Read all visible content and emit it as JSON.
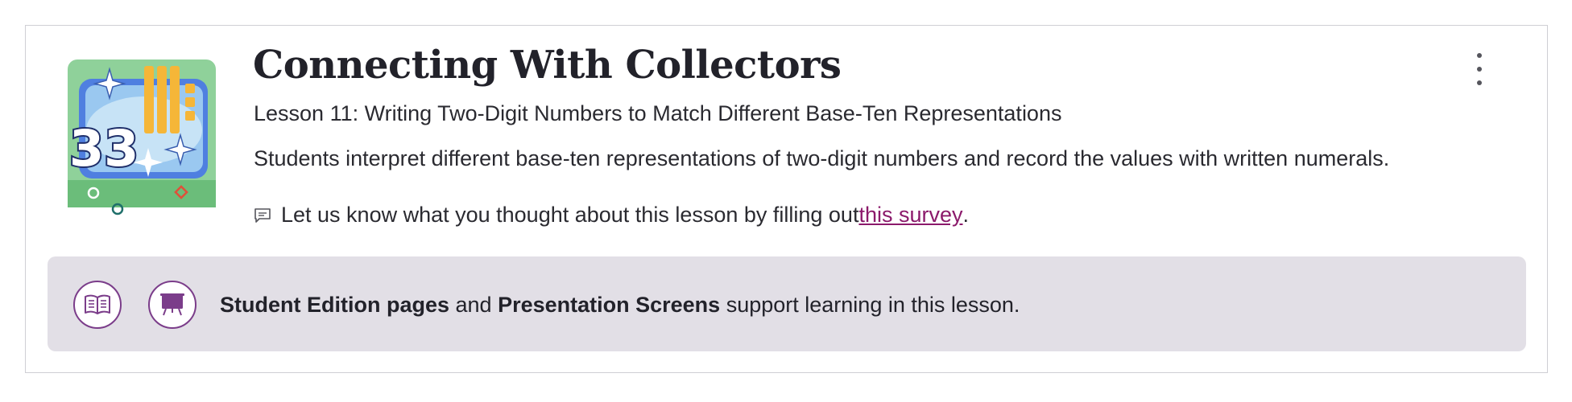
{
  "lesson": {
    "title": "Connecting With Collectors",
    "subtitle": "Lesson 11: Writing Two-Digit Numbers to Match Different Base-Ten Representations",
    "description": "Students interpret different base-ten representations of two-digit numbers and record the values with written numerals.",
    "thumbnail_number": "33"
  },
  "survey": {
    "prefix": "Let us know what you thought about this lesson by filling out ",
    "link_text": "this survey",
    "suffix": "."
  },
  "banner": {
    "part1": "Student Edition pages",
    "part2": " and ",
    "part3": "Presentation Screens",
    "part4": " support learning in this lesson."
  },
  "colors": {
    "accent": "#7b3d8a",
    "link": "#8b1a6b",
    "banner_bg": "#e2dfe6"
  },
  "icons": {
    "menu": "kebab-menu-icon",
    "survey": "chat-icon",
    "student_edition": "book-icon",
    "presentation": "presentation-screen-icon"
  }
}
